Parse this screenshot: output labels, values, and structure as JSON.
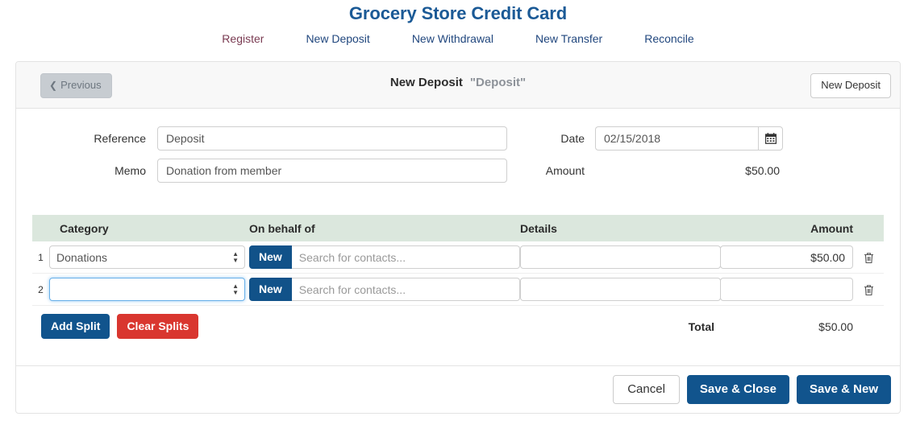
{
  "header": {
    "title": "Grocery Store Credit Card",
    "nav": [
      {
        "label": "Register"
      },
      {
        "label": "New Deposit"
      },
      {
        "label": "New Withdrawal"
      },
      {
        "label": "New Transfer"
      },
      {
        "label": "Reconcile"
      }
    ]
  },
  "panel": {
    "previous_label": "Previous",
    "title": "New Deposit",
    "title_quoted": "\"Deposit\"",
    "new_deposit_label": "New Deposit"
  },
  "form": {
    "reference_label": "Reference",
    "reference_value": "Deposit",
    "memo_label": "Memo",
    "memo_value": "Donation from member",
    "date_label": "Date",
    "date_value": "02/15/2018",
    "calendar_icon": "calendar-icon",
    "amount_label": "Amount",
    "amount_value": "$50.00"
  },
  "splits": {
    "columns": {
      "category": "Category",
      "on_behalf_of": "On behalf of",
      "details": "Details",
      "amount": "Amount"
    },
    "contacts_placeholder": "Search for contacts...",
    "new_button_label": "New",
    "delete_icon": "trash-icon",
    "rows": [
      {
        "number": "1",
        "category": "Donations",
        "on_behalf_of": "",
        "details": "",
        "amount": "$50.00",
        "focused": false
      },
      {
        "number": "2",
        "category": "",
        "on_behalf_of": "",
        "details": "",
        "amount": "",
        "focused": true
      }
    ],
    "add_split_label": "Add Split",
    "clear_splits_label": "Clear Splits",
    "total_label": "Total",
    "total_value": "$50.00"
  },
  "footer": {
    "cancel_label": "Cancel",
    "save_close_label": "Save & Close",
    "save_new_label": "Save & New"
  },
  "colors": {
    "title_blue": "#1b5a96",
    "nav_blue": "#21477e",
    "primary_blue": "#11548d",
    "danger_red": "#d9362f",
    "table_header_green": "#dbe7dd",
    "panel_head_gray": "#f8f8f8"
  }
}
